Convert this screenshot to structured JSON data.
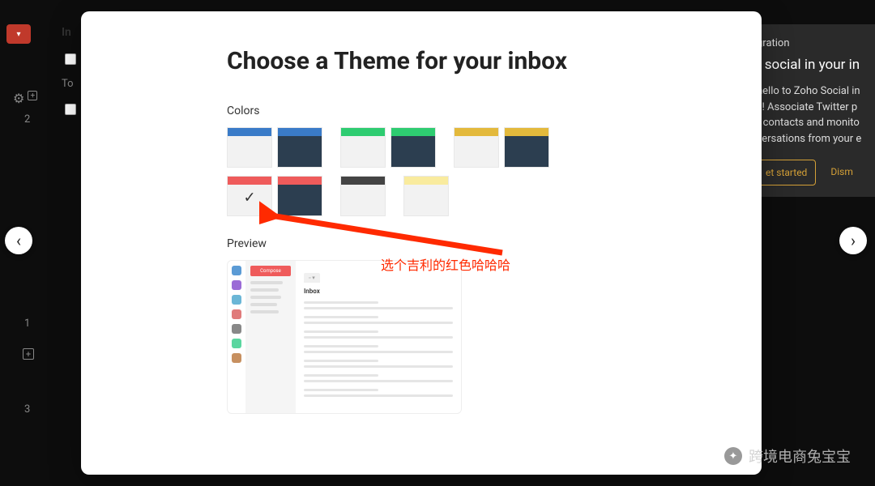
{
  "background": {
    "inbox_label": "In",
    "today_label": "To",
    "sidebar_nums": [
      "2",
      "1",
      "3"
    ],
    "right_card": {
      "eyebrow": "gration",
      "title": "t social in your in",
      "body1": "hello to Zoho Social in",
      "body2": "x! Associate Twitter p",
      "body3": "r contacts and monito",
      "body4": "versations from your e",
      "get_started": "et started",
      "dismiss": "Dism"
    }
  },
  "modal": {
    "title": "Choose a Theme for your inbox",
    "colors_label": "Colors",
    "preview_label": "Preview",
    "themes": [
      {
        "name": "blue-light"
      },
      {
        "name": "blue-dark"
      },
      {
        "name": "green-light"
      },
      {
        "name": "green-dark"
      },
      {
        "name": "yellow-light"
      },
      {
        "name": "yellow-dark"
      },
      {
        "name": "red-light",
        "selected": true
      },
      {
        "name": "red-dark"
      },
      {
        "name": "gray-light"
      },
      {
        "name": "lightyellow-light"
      }
    ],
    "preview": {
      "compose_label": "Compose",
      "inbox_label": "Inbox",
      "rail_colors": [
        "#5b9bd5",
        "#9b6bd6",
        "#6bb6d6",
        "#e07b7b",
        "#888888",
        "#5bd6a0",
        "#c79060"
      ]
    }
  },
  "annotation": {
    "text": "选个吉利的红色哈哈哈"
  },
  "watermark": {
    "text": "跨境电商兔宝宝"
  }
}
